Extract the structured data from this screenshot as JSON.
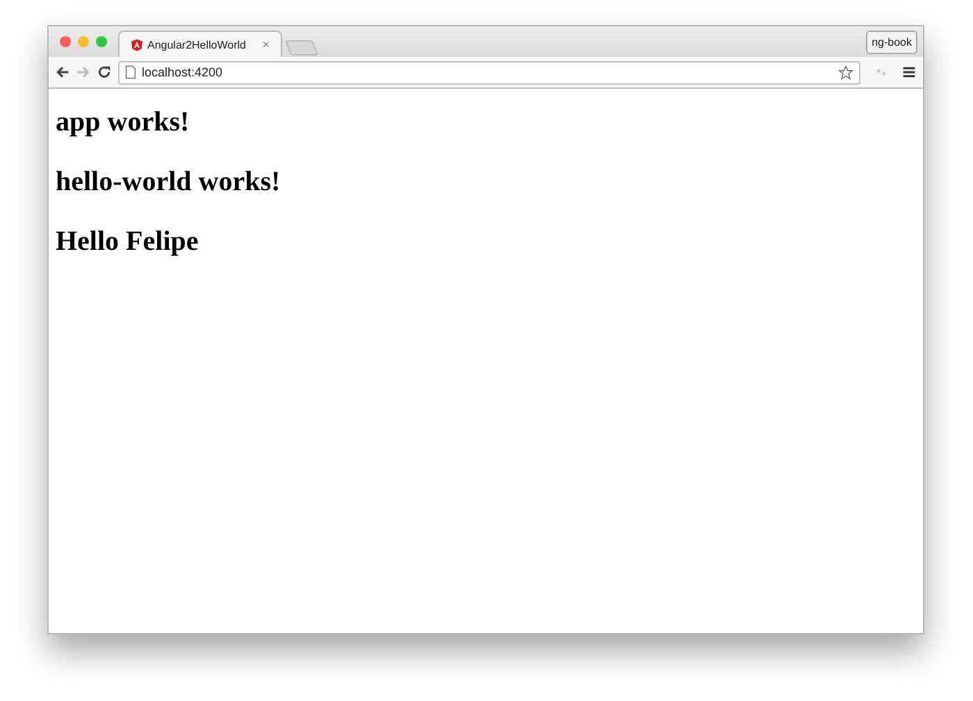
{
  "window": {
    "badge": "ng-book"
  },
  "tabs": [
    {
      "title": "Angular2HelloWorld",
      "close": "×",
      "selected": true
    }
  ],
  "address_bar": {
    "url": "localhost:4200"
  },
  "page": {
    "headings": [
      "app works!",
      "hello-world works!",
      "Hello Felipe"
    ]
  }
}
